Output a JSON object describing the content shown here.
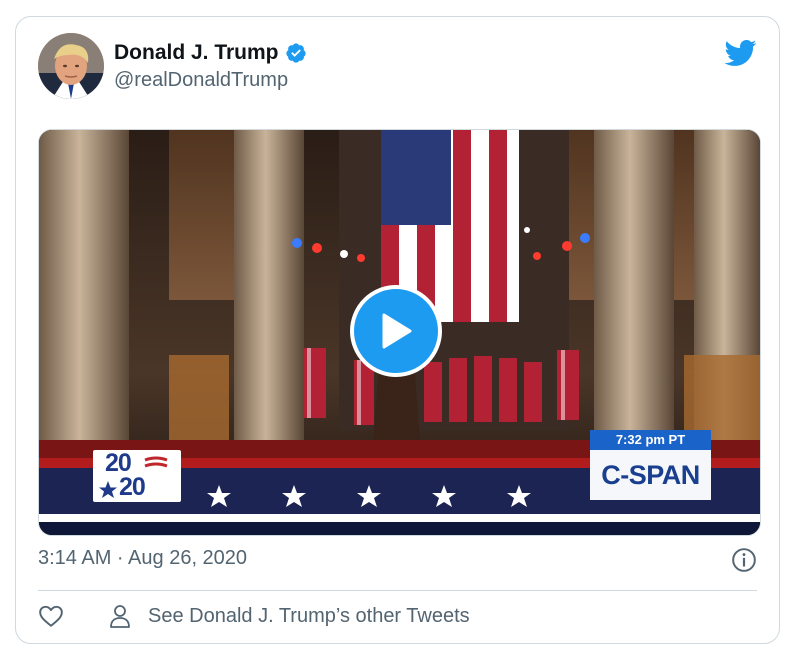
{
  "tweet": {
    "display_name": "Donald J. Trump",
    "handle": "@realDonaldTrump",
    "verified": true,
    "timestamp": "3:14 AM · Aug 26, 2020"
  },
  "media": {
    "type": "video",
    "overlay_logo_top": "20",
    "overlay_logo_bottom": "20",
    "broadcast_time": "7:32 pm PT",
    "broadcast_network": "C-SPAN"
  },
  "actions": {
    "other_tweets_label": "See Donald J. Trump’s other Tweets"
  },
  "colors": {
    "accent": "#1d9bf0",
    "secondary_text": "#536471",
    "border": "#cfd9de"
  },
  "icons": [
    "twitter-bird-icon",
    "verified-badge-icon",
    "play-icon",
    "info-icon",
    "heart-icon",
    "person-icon"
  ]
}
